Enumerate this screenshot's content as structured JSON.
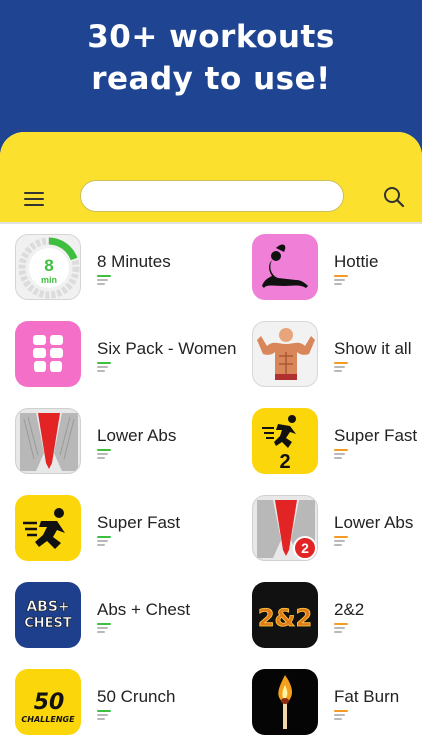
{
  "banner": {
    "line1": "30+ workouts",
    "line2": "ready to use!"
  },
  "toolbar": {
    "menu_icon": "hamburger-menu-icon",
    "search_value": "",
    "search_icon": "magnifier-icon"
  },
  "colors": {
    "banner_bg": "#1f4592",
    "toolbar_bg": "#fbe02e",
    "level_green": "#3fbf3f",
    "level_orange": "#f59a23",
    "level_gray": "#b9b9b9"
  },
  "workouts": [
    {
      "title": "8 Minutes",
      "icon": "timer-8-min-icon",
      "level": 1,
      "level_color": "green",
      "timer_number": "8",
      "timer_unit": "min"
    },
    {
      "title": "Hottie",
      "icon": "pinup-silhouette-icon",
      "level": 1,
      "level_color": "orange"
    },
    {
      "title": "Six Pack - Women",
      "icon": "six-pack-abs-icon",
      "level": 1,
      "level_color": "green"
    },
    {
      "title": "Show it all",
      "icon": "flexing-man-icon",
      "level": 1,
      "level_color": "orange"
    },
    {
      "title": "Lower Abs",
      "icon": "lower-abs-muscle-icon",
      "level": 1,
      "level_color": "green"
    },
    {
      "title": "Super Fast",
      "icon": "running-man-2-icon",
      "level": 1,
      "level_color": "orange",
      "badge": "2"
    },
    {
      "title": "Super Fast",
      "icon": "running-man-icon",
      "level": 1,
      "level_color": "green"
    },
    {
      "title": "Lower Abs",
      "icon": "lower-abs-muscle-2-icon",
      "level": 1,
      "level_color": "orange",
      "badge": "2"
    },
    {
      "title": "Abs + Chest",
      "icon": "abs-chest-text-icon",
      "level": 1,
      "level_color": "green",
      "icon_text1": "ABS+",
      "icon_text2": "CHEST"
    },
    {
      "title": "2&2",
      "icon": "fiery-2and2-icon",
      "level": 1,
      "level_color": "orange",
      "icon_text1": "2&2"
    },
    {
      "title": "50 Crunch",
      "icon": "50-challenge-icon",
      "level": 1,
      "level_color": "green",
      "icon_text1": "50",
      "icon_text2": "CHALLENGE"
    },
    {
      "title": "Fat Burn",
      "icon": "burning-match-icon",
      "level": 1,
      "level_color": "orange"
    }
  ]
}
